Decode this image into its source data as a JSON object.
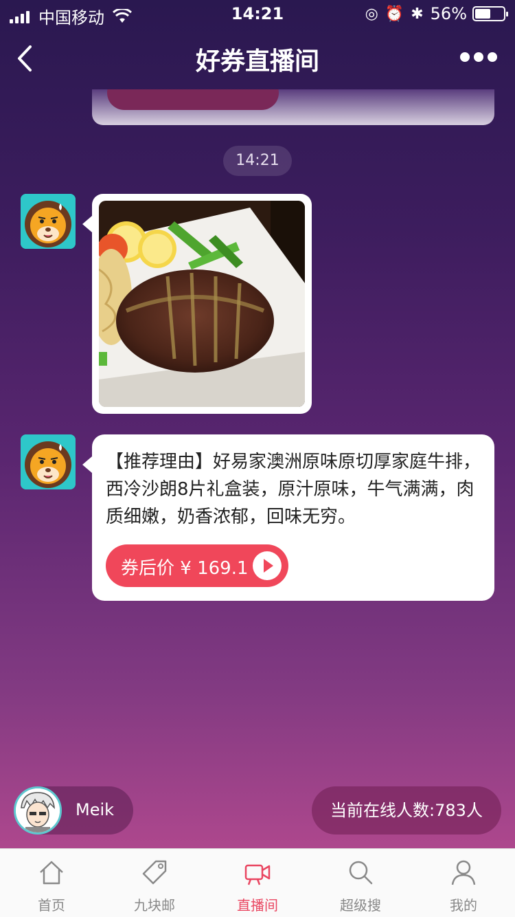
{
  "status_bar": {
    "carrier": "中国移动",
    "time": "14:21",
    "battery_percent": "56%",
    "battery_level": 0.56
  },
  "nav": {
    "title": "好券直播间"
  },
  "chat": {
    "timestamp": "14:21",
    "recommendation_text": "【推荐理由】好易家澳洲原味原切厚家庭牛排，西冷沙朗8片礼盒装，原汁原味，牛气满满，肉质细嫩，奶香浓郁，回味无穷。",
    "price_label": "券后价 ¥ 169.1"
  },
  "footer": {
    "user_name": "Meik",
    "online_count": "当前在线人数:783人"
  },
  "tabs": [
    {
      "label": "首页",
      "icon": "home-icon",
      "active": false
    },
    {
      "label": "九块邮",
      "icon": "tag-icon",
      "active": false
    },
    {
      "label": "直播间",
      "icon": "video-camera-icon",
      "active": true
    },
    {
      "label": "超级搜",
      "icon": "search-icon",
      "active": false
    },
    {
      "label": "我的",
      "icon": "user-icon",
      "active": false
    }
  ],
  "colors": {
    "accent": "#f0475a",
    "tab_active": "#e94560",
    "tab_inactive": "#888888"
  }
}
